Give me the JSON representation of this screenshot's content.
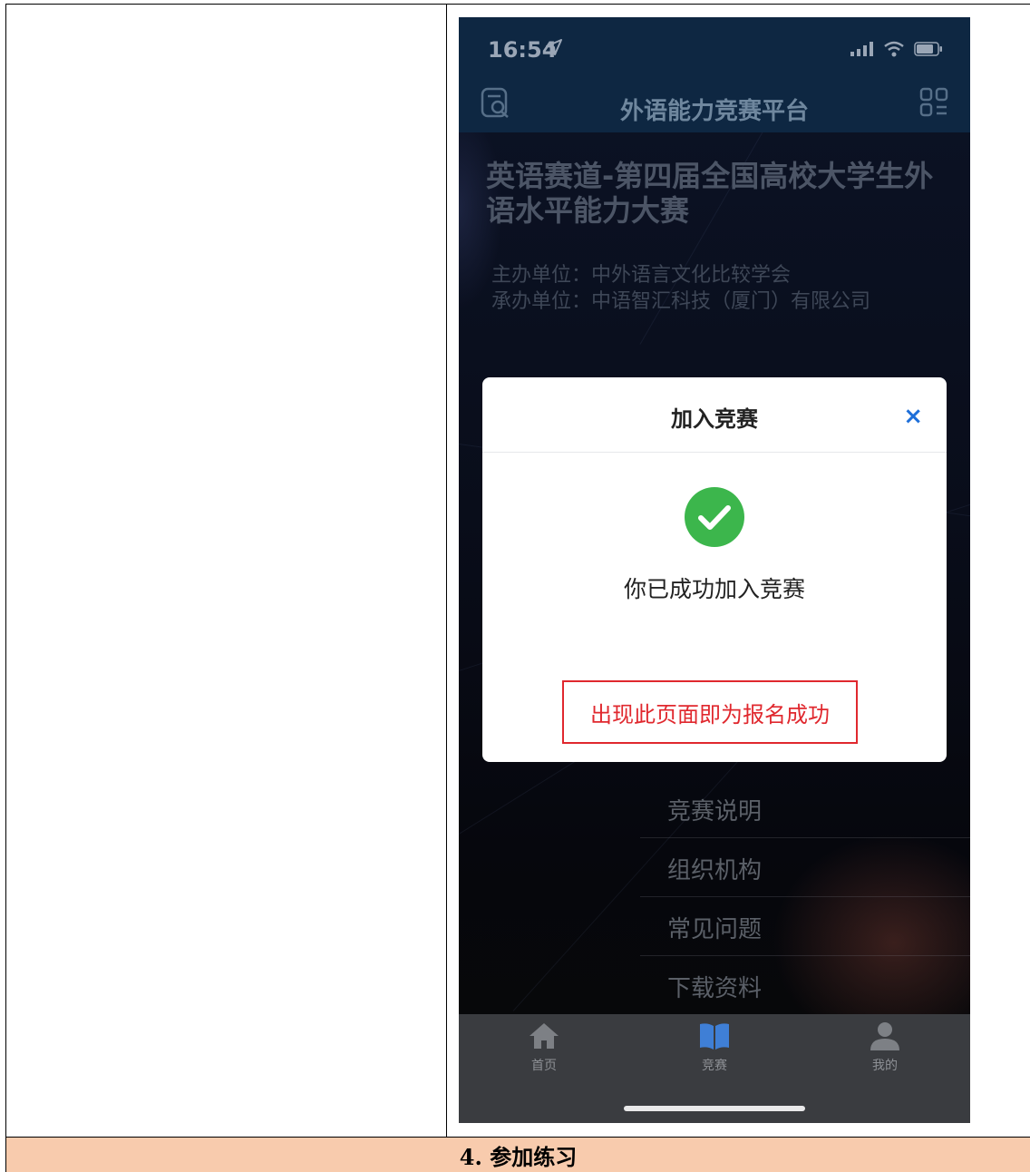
{
  "phone": {
    "status_time": "16:54",
    "nav_title": "外语能力竞赛平台",
    "hero_title": "英语赛道-第四届全国高校大学生外语水平能力大赛",
    "organizer": "主办单位：中外语言文化比较学会",
    "co_organizer": "承办单位：中语智汇科技（厦门）有限公司",
    "modal": {
      "title": "加入竞赛",
      "close": "×",
      "success_text": "你已成功加入竞赛",
      "note": "出现此页面即为报名成功"
    },
    "menu": [
      {
        "label": "竞赛说明"
      },
      {
        "label": "组织机构"
      },
      {
        "label": "常见问题"
      },
      {
        "label": "下载资料"
      }
    ],
    "tabs": [
      {
        "label": "首页",
        "icon": "home-icon"
      },
      {
        "label": "竞赛",
        "icon": "book-icon"
      },
      {
        "label": "我的",
        "icon": "user-icon"
      }
    ],
    "colors": {
      "nav_bg": "#0e2742",
      "success_green": "#3cb64c",
      "note_red": "#e0282e",
      "close_blue": "#1e6fd9",
      "step_band": "#f8cbad"
    }
  },
  "step_title": "4. 参加练习"
}
